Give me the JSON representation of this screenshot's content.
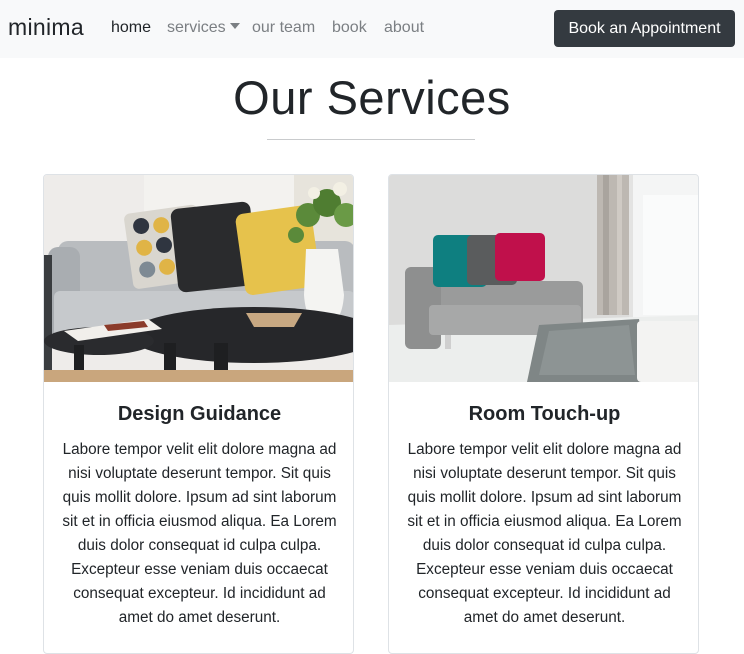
{
  "nav": {
    "brand": "minima",
    "links": [
      {
        "label": "home"
      },
      {
        "label": "services"
      },
      {
        "label": "our team"
      },
      {
        "label": "book"
      },
      {
        "label": "about"
      }
    ],
    "cta_label": "Book an Appointment"
  },
  "section": {
    "title": "Our Services"
  },
  "cards": [
    {
      "title": "Design Guidance",
      "text": "Labore tempor velit elit dolore magna ad nisi voluptate deserunt tempor. Sit quis quis mollit dolore. Ipsum ad sint laborum sit et in officia eiusmod aliqua. Ea Lorem duis dolor consequat id culpa culpa. Excepteur esse veniam duis occaecat consequat excepteur. Id incididunt ad amet do amet deserunt."
    },
    {
      "title": "Room Touch-up",
      "text": "Labore tempor velit elit dolore magna ad nisi voluptate deserunt tempor. Sit quis quis mollit dolore. Ipsum ad sint laborum sit et in officia eiusmod aliqua. Ea Lorem duis dolor consequat id culpa culpa. Excepteur esse veniam duis occaecat consequat excepteur. Id incididunt ad amet do amet deserunt."
    }
  ],
  "colors": {
    "navbar_bg": "#f8f9fa",
    "button_bg": "#343a40",
    "text": "#212529",
    "nav_muted": "#7b7f83"
  }
}
